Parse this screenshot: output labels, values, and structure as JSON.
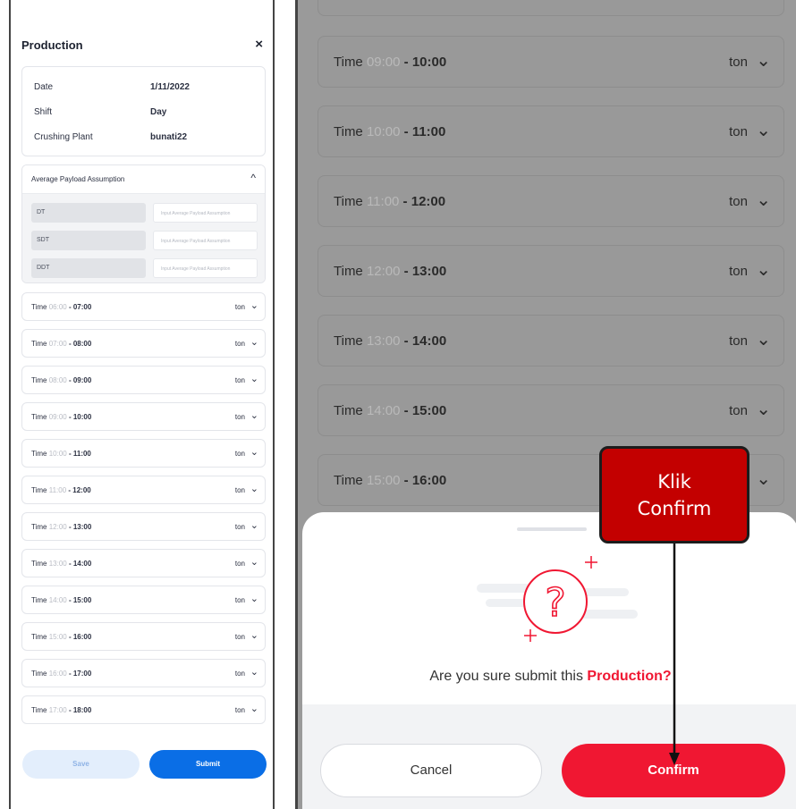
{
  "left_panel": {
    "title": "Production",
    "close_symbol": "×",
    "info": [
      {
        "label": "Date",
        "value": "1/11/2022"
      },
      {
        "label": "Shift",
        "value": "Day"
      },
      {
        "label": "Crushing Plant",
        "value": "bunati22"
      }
    ],
    "payload": {
      "title": "Average Payload Assumption",
      "caret": "^",
      "rows": [
        {
          "label": "DT",
          "placeholder": "Input Average Payload Assumption"
        },
        {
          "label": "SDT",
          "placeholder": "Input Average Payload Assumption"
        },
        {
          "label": "DDT",
          "placeholder": "Input Average Payload Assumption"
        }
      ]
    },
    "slots": [
      {
        "label": "Time",
        "start": "06:00",
        "end": " - 07:00",
        "unit": "ton"
      },
      {
        "label": "Time",
        "start": "07:00",
        "end": " - 08:00",
        "unit": "ton"
      },
      {
        "label": "Time",
        "start": "08:00",
        "end": " - 09:00",
        "unit": "ton"
      },
      {
        "label": "Time",
        "start": "09:00",
        "end": " - 10:00",
        "unit": "ton"
      },
      {
        "label": "Time",
        "start": "10:00",
        "end": " - 11:00",
        "unit": "ton"
      },
      {
        "label": "Time",
        "start": "11:00",
        "end": " - 12:00",
        "unit": "ton"
      },
      {
        "label": "Time",
        "start": "12:00",
        "end": " - 13:00",
        "unit": "ton"
      },
      {
        "label": "Time",
        "start": "13:00",
        "end": " - 14:00",
        "unit": "ton"
      },
      {
        "label": "Time",
        "start": "14:00",
        "end": " - 15:00",
        "unit": "ton"
      },
      {
        "label": "Time",
        "start": "15:00",
        "end": " - 16:00",
        "unit": "ton"
      },
      {
        "label": "Time",
        "start": "16:00",
        "end": " - 17:00",
        "unit": "ton"
      },
      {
        "label": "Time",
        "start": "17:00",
        "end": " - 18:00",
        "unit": "ton"
      }
    ],
    "save_label": "Save",
    "submit_label": "Submit"
  },
  "right_panel": {
    "slots": [
      {
        "label": "Time",
        "start": "09:00",
        "end": " - 10:00",
        "unit": "ton"
      },
      {
        "label": "Time",
        "start": "10:00",
        "end": " - 11:00",
        "unit": "ton"
      },
      {
        "label": "Time",
        "start": "11:00",
        "end": " - 12:00",
        "unit": "ton"
      },
      {
        "label": "Time",
        "start": "12:00",
        "end": " - 13:00",
        "unit": "ton"
      },
      {
        "label": "Time",
        "start": "13:00",
        "end": " - 14:00",
        "unit": "ton"
      },
      {
        "label": "Time",
        "start": "14:00",
        "end": " - 15:00",
        "unit": "ton"
      },
      {
        "label": "Time",
        "start": "15:00",
        "end": " - 16:00",
        "unit": "ton"
      }
    ],
    "dialog": {
      "question_prefix": "Are you sure submit this ",
      "question_highlight": "Production?",
      "cancel_label": "Cancel",
      "confirm_label": "Confirm"
    },
    "callout": {
      "line1": "Klik",
      "line2": "Confirm"
    }
  },
  "icons": {
    "chevron": "chevron-down-icon",
    "close": "close-icon",
    "question": "question-mark-icon"
  },
  "colors": {
    "primary_blue": "#0a6ee6",
    "danger_red": "#f01732",
    "callout_red": "#c30000",
    "overlay_grey": "#9a9a9a"
  }
}
